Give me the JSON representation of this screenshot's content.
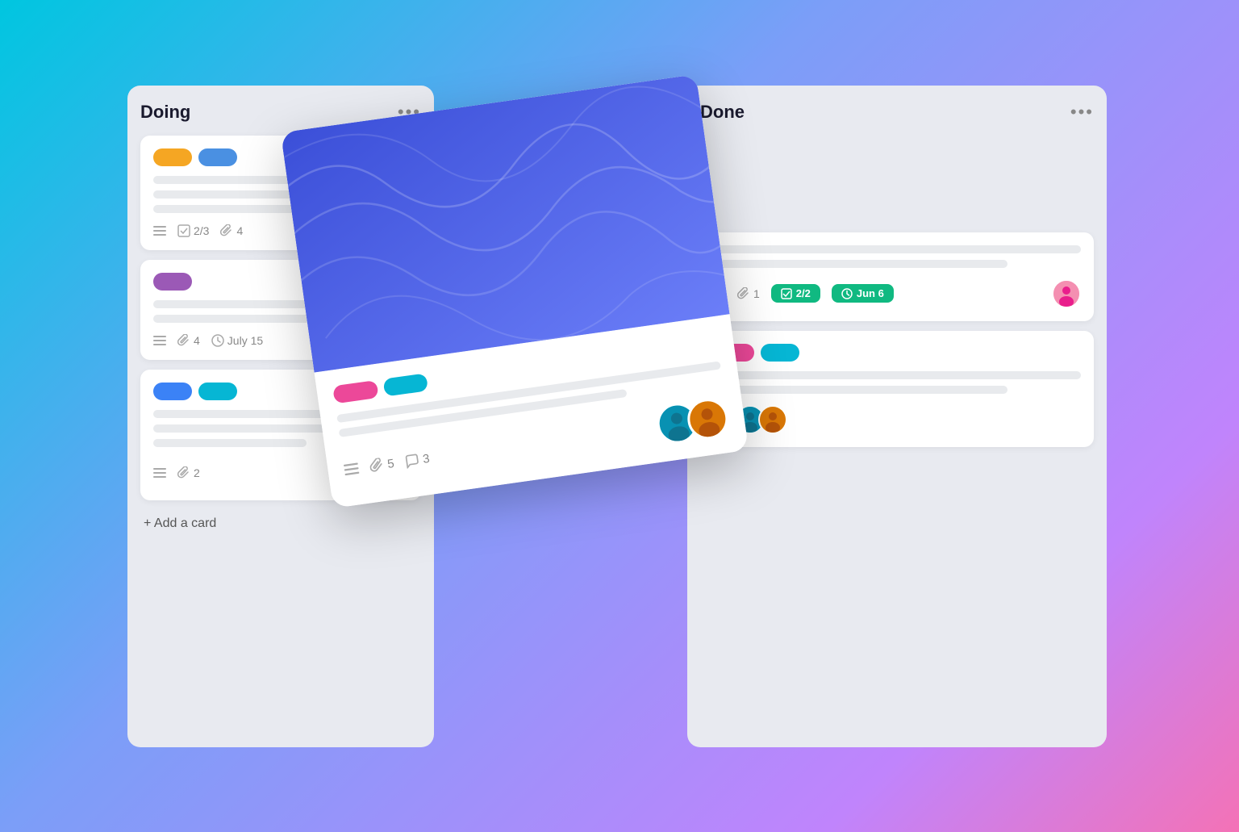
{
  "board": {
    "columns": [
      {
        "id": "doing",
        "title": "Doing",
        "menu_label": "•••",
        "cards": [
          {
            "id": "card-1",
            "tags": [
              {
                "color": "yellow",
                "label": ""
              },
              {
                "color": "blue",
                "label": ""
              }
            ],
            "lines": [
              "long",
              "medium",
              "short"
            ],
            "footer": {
              "has_list": true,
              "checklist": "2/3",
              "attachments": "4"
            }
          },
          {
            "id": "card-2",
            "tags": [
              {
                "color": "purple",
                "label": ""
              }
            ],
            "lines": [
              "long",
              "medium"
            ],
            "footer": {
              "has_list": true,
              "attachments": "4",
              "date": "July 15"
            }
          },
          {
            "id": "card-3",
            "tags": [
              {
                "color": "blue-dark",
                "label": ""
              },
              {
                "color": "cyan",
                "label": ""
              }
            ],
            "lines": [
              "long",
              "medium",
              "short"
            ],
            "footer": {
              "has_list": true,
              "attachments": "2"
            },
            "avatars": [
              "yellow",
              "purple"
            ]
          }
        ],
        "add_card_label": "+ Add a card"
      },
      {
        "id": "done",
        "title": "Done",
        "menu_label": "•••",
        "cards": [
          {
            "id": "done-card-1",
            "lines": [
              "long",
              "medium"
            ],
            "footer": {
              "has_list": true,
              "attachments": "1",
              "checklist_badge": "2/2",
              "date_badge": "Jun 6"
            },
            "avatars": [
              "pink"
            ]
          },
          {
            "id": "done-card-2",
            "tags": [
              {
                "color": "pink",
                "label": ""
              },
              {
                "color": "cyan",
                "label": ""
              }
            ],
            "lines": [
              "long",
              "medium"
            ],
            "footer": {},
            "avatars": [
              "purple2",
              "cyan2",
              "gold2"
            ]
          }
        ]
      }
    ],
    "floating_card": {
      "tags": [
        {
          "color": "pink",
          "label": ""
        },
        {
          "color": "cyan",
          "label": ""
        }
      ],
      "lines": [
        "long",
        "medium"
      ],
      "footer": {
        "has_list": true,
        "attachments": "5",
        "comments": "3"
      },
      "avatars": [
        "cyan",
        "gold"
      ]
    }
  }
}
